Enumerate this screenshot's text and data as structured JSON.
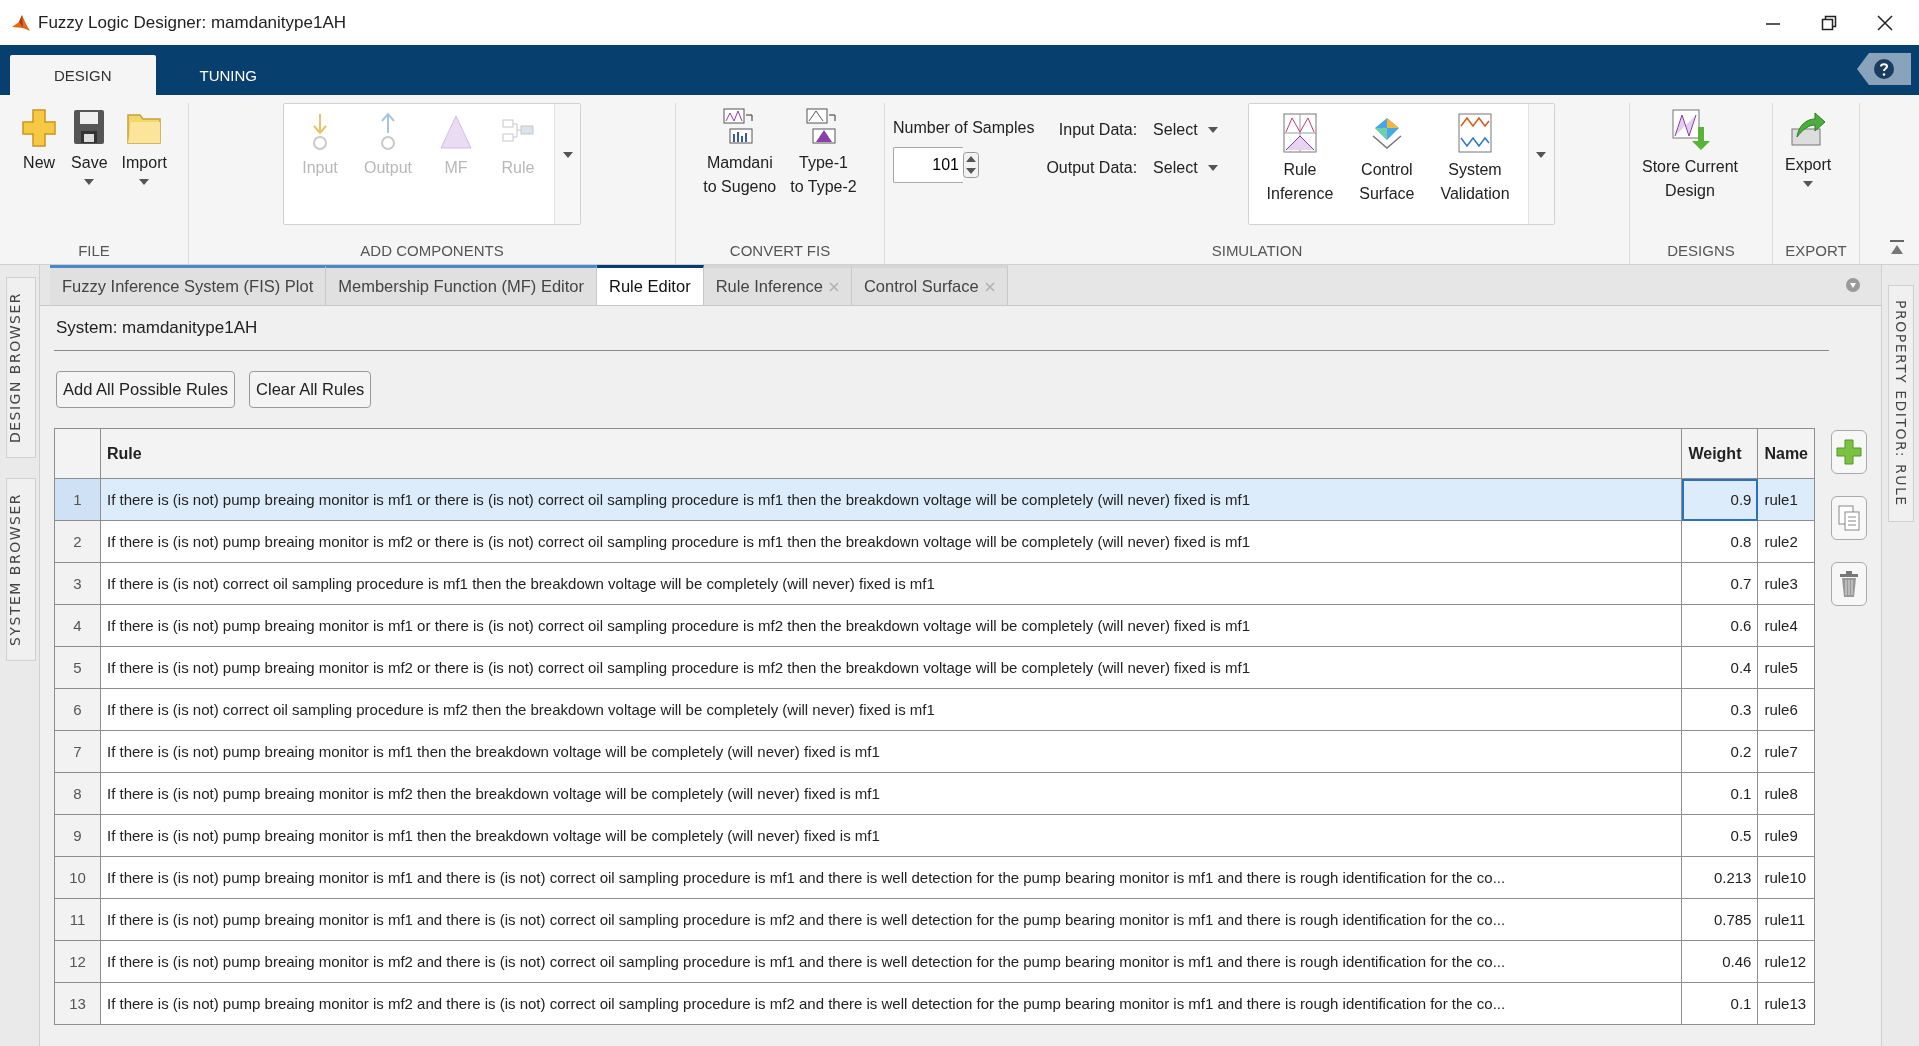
{
  "window": {
    "title": "Fuzzy Logic Designer: mamdanitype1AH"
  },
  "ribbon_tabs": [
    {
      "label": "DESIGN",
      "selected": true
    },
    {
      "label": "TUNING",
      "selected": false
    }
  ],
  "ribbon_sections": [
    {
      "title": "FILE",
      "items": [
        {
          "kind": "button",
          "label": "New"
        },
        {
          "kind": "button",
          "label": "Save",
          "dropdown": true
        },
        {
          "kind": "button",
          "label": "Import",
          "dropdown": true
        }
      ]
    },
    {
      "title": "ADD COMPONENTS",
      "items": [
        {
          "kind": "gallery-button",
          "label": "Input",
          "disabled": true
        },
        {
          "kind": "gallery-button",
          "label": "Output",
          "disabled": true
        },
        {
          "kind": "gallery-button",
          "label": "MF",
          "disabled": true
        },
        {
          "kind": "gallery-button",
          "label": "Rule",
          "disabled": true
        }
      ]
    },
    {
      "title": "CONVERT FIS",
      "items": [
        {
          "kind": "button",
          "label": "Mamdani\nto Sugeno"
        },
        {
          "kind": "button",
          "label": "Type-1\nto Type-2"
        }
      ]
    },
    {
      "title": "SIMULATION",
      "items": [
        {
          "kind": "spinner",
          "label": "Number of Samples",
          "value": "101"
        },
        {
          "kind": "select",
          "label": "Input Data:",
          "value": "Select"
        },
        {
          "kind": "select",
          "label": "Output Data:",
          "value": "Select"
        },
        {
          "kind": "gallery-button",
          "label": "Rule\nInference"
        },
        {
          "kind": "gallery-button",
          "label": "Control\nSurface"
        },
        {
          "kind": "gallery-button",
          "label": "System\nValidation"
        }
      ]
    },
    {
      "title": "DESIGNS",
      "items": [
        {
          "kind": "button",
          "label": "Store Current\nDesign"
        }
      ]
    },
    {
      "title": "EXPORT",
      "items": [
        {
          "kind": "button",
          "label": "Export",
          "dropdown": true
        }
      ]
    }
  ],
  "left_panels": [
    {
      "label": "DESIGN BROWSER"
    },
    {
      "label": "SYSTEM BROWSER"
    }
  ],
  "right_panel": {
    "label": "PROPERTY EDITOR: RULE"
  },
  "doc_tabs": [
    {
      "label": "Fuzzy Inference System (FIS) Plot",
      "selected": false,
      "closable": false
    },
    {
      "label": "Membership Function (MF) Editor",
      "selected": false,
      "closable": false
    },
    {
      "label": "Rule Editor",
      "selected": true,
      "closable": false
    },
    {
      "label": "Rule Inference",
      "selected": false,
      "closable": true
    },
    {
      "label": "Control Surface",
      "selected": false,
      "closable": true
    }
  ],
  "system_label": "System: mamdanitype1AH",
  "actions": [
    "Add All Possible Rules",
    "Clear All Rules"
  ],
  "table": {
    "columns": [
      "Rule",
      "Weight",
      "Name"
    ],
    "rows": [
      {
        "index": "1",
        "rule": "If there is (is not) pump breaing monitor is mf1 or there is (is not) correct oil sampling procedure is mf1 then the breakdown voltage will be completely (will never) fixed is mf1",
        "weight": "0.9",
        "name": "rule1",
        "selected": true
      },
      {
        "index": "2",
        "rule": "If there is (is not) pump breaing monitor is mf2 or there is (is not) correct oil sampling procedure is mf1 then the breakdown voltage will be completely (will never) fixed is mf1",
        "weight": "0.8",
        "name": "rule2",
        "selected": false
      },
      {
        "index": "3",
        "rule": "If there is (is not) correct oil sampling procedure is mf1 then the breakdown voltage will be completely (will never) fixed is mf1",
        "weight": "0.7",
        "name": "rule3",
        "selected": false
      },
      {
        "index": "4",
        "rule": "If there is (is not) pump breaing monitor is mf1 or there is (is not) correct oil sampling procedure is mf2 then the breakdown voltage will be completely (will never) fixed is mf1",
        "weight": "0.6",
        "name": "rule4",
        "selected": false
      },
      {
        "index": "5",
        "rule": "If there is (is not) pump breaing monitor is mf2 or there is (is not) correct oil sampling procedure is mf2 then the breakdown voltage will be completely (will never) fixed is mf1",
        "weight": "0.4",
        "name": "rule5",
        "selected": false
      },
      {
        "index": "6",
        "rule": "If there is (is not) correct oil sampling procedure is mf2 then the breakdown voltage will be completely (will never) fixed is mf1",
        "weight": "0.3",
        "name": "rule6",
        "selected": false
      },
      {
        "index": "7",
        "rule": "If there is (is not) pump breaing monitor is mf1 then the breakdown voltage will be completely (will never) fixed is mf1",
        "weight": "0.2",
        "name": "rule7",
        "selected": false
      },
      {
        "index": "8",
        "rule": "If there is (is not) pump breaing monitor is mf2 then the breakdown voltage will be completely (will never) fixed is mf1",
        "weight": "0.1",
        "name": "rule8",
        "selected": false
      },
      {
        "index": "9",
        "rule": "If there is (is not) pump breaing monitor is mf1 then the breakdown voltage will be completely (will never) fixed is mf1",
        "weight": "0.5",
        "name": "rule9",
        "selected": false
      },
      {
        "index": "10",
        "rule": "If there is (is not) pump breaing monitor is mf1 and there is (is not) correct oil sampling procedure is mf1 and there is well detection for the pump bearing monitor is mf1 and there is rough identification for the co...",
        "weight": "0.213",
        "name": "rule10",
        "selected": false
      },
      {
        "index": "11",
        "rule": "If there is (is not) pump breaing monitor is mf1 and there is (is not) correct oil sampling procedure is mf2 and there is well detection for the pump bearing monitor is mf1 and there is rough identification for the co...",
        "weight": "0.785",
        "name": "rule11",
        "selected": false
      },
      {
        "index": "12",
        "rule": "If there is (is not) pump breaing monitor is mf2 and there is (is not) correct oil sampling procedure is mf1 and there is well detection for the pump bearing monitor is mf1 and there is rough identification for the co...",
        "weight": "0.46",
        "name": "rule12",
        "selected": false
      },
      {
        "index": "13",
        "rule": "If there is (is not) pump breaing monitor is mf2 and there is (is not) correct oil sampling procedure is mf2 and there is well detection for the pump bearing monitor is mf1 and there is rough identification for the co...",
        "weight": "0.1",
        "name": "rule13",
        "selected": false
      }
    ]
  }
}
